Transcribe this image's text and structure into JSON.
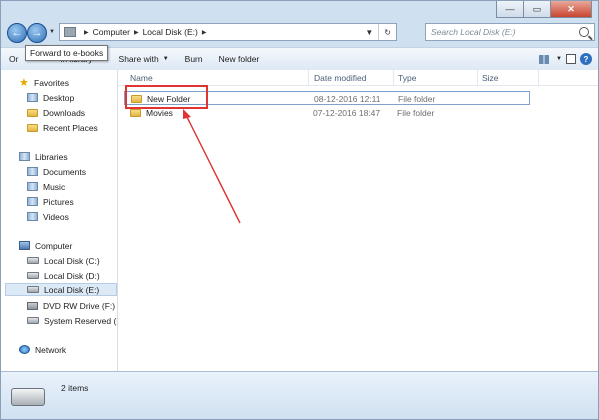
{
  "window": {
    "controls": {
      "minimize": "—",
      "maximize": "▭",
      "close": "✕"
    }
  },
  "nav": {
    "tooltip": "Forward to e-books",
    "breadcrumb": [
      "Computer",
      "Local Disk (E:)"
    ],
    "search_placeholder": "Search Local Disk (E:)"
  },
  "toolbar": {
    "organize": "Or",
    "include_in_library": "in library",
    "share_with": "Share with",
    "burn": "Burn",
    "new_folder": "New folder"
  },
  "sidebar": {
    "favorites": {
      "label": "Favorites",
      "items": [
        "Desktop",
        "Downloads",
        "Recent Places"
      ]
    },
    "libraries": {
      "label": "Libraries",
      "items": [
        "Documents",
        "Music",
        "Pictures",
        "Videos"
      ]
    },
    "computer": {
      "label": "Computer",
      "items": [
        "Local Disk (C:)",
        "Local Disk (D:)",
        "Local Disk (E:)",
        "DVD RW Drive (F:) Sc",
        "System Reserved (H:"
      ]
    },
    "network": {
      "label": "Network"
    },
    "selected": "Local Disk (E:)"
  },
  "columns": {
    "name": "Name",
    "date_modified": "Date modified",
    "type": "Type",
    "size": "Size"
  },
  "files": [
    {
      "name": "New Folder",
      "date": "08-12-2016 12:11",
      "type": "File folder",
      "size": ""
    },
    {
      "name": "Movies",
      "date": "07-12-2016 18:47",
      "type": "File folder",
      "size": ""
    }
  ],
  "status": {
    "item_count": "2 items"
  },
  "annotation": {
    "color": "#e03434",
    "target": "New Folder"
  }
}
